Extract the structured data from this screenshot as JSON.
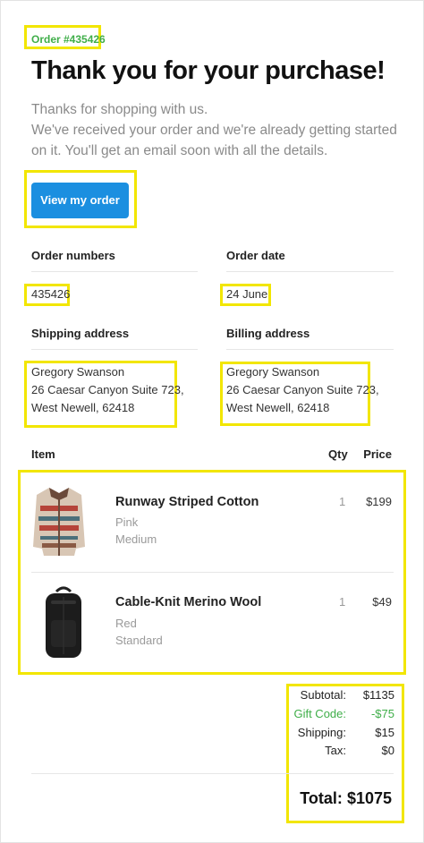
{
  "order_tag": "Order #435426",
  "title": "Thank you for your purchase!",
  "intro": {
    "line1": "Thanks for shopping with us.",
    "line2": "We've received your order and we're already getting started on it. You'll get an email soon with all the details."
  },
  "button": {
    "label": "View my order"
  },
  "details": {
    "order_numbers_label": "Order numbers",
    "order_numbers_value": "435426",
    "order_date_label": "Order date",
    "order_date_value": "24 June",
    "shipping_label": "Shipping address",
    "shipping": [
      "Gregory Swanson",
      "26 Caesar Canyon Suite 723,",
      "West Newell, 62418"
    ],
    "billing_label": "Billing address",
    "billing": [
      "Gregory Swanson",
      "26 Caesar Canyon Suite 723,",
      "West Newell, 62418"
    ]
  },
  "table": {
    "headers": {
      "item": "Item",
      "qty": "Qty",
      "price": "Price"
    },
    "items": [
      {
        "name": "Runway Striped Cotton",
        "color": "Pink",
        "size": "Medium",
        "qty": "1",
        "price": "$199",
        "image": "sweater-image"
      },
      {
        "name": "Cable-Knit Merino Wool",
        "color": "Red",
        "size": "Standard",
        "qty": "1",
        "price": "$49",
        "image": "backpack-image"
      }
    ]
  },
  "summary": {
    "subtotal_label": "Subtotal:",
    "subtotal": "$1135",
    "gift_label": "Gift Code:",
    "gift": "-$75",
    "shipping_label": "Shipping:",
    "shipping": "$15",
    "tax_label": "Tax:",
    "tax": "$0",
    "total_label": "Total:",
    "total": "$1075"
  },
  "colors": {
    "accent": "#1b8fe0",
    "green": "#3fae49",
    "highlight": "#f2e600"
  }
}
